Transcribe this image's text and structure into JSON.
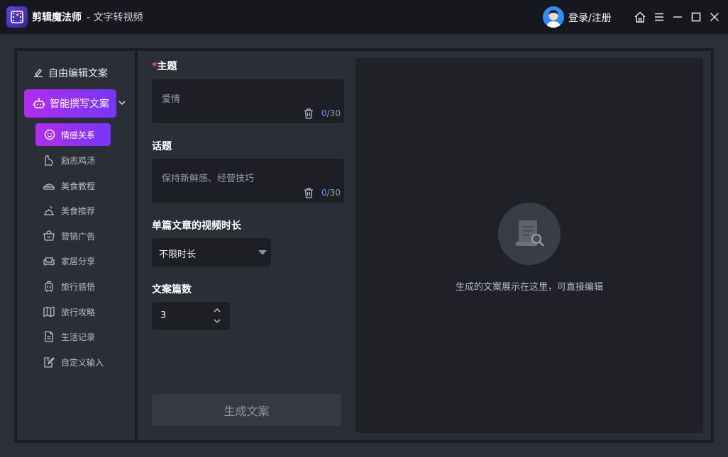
{
  "titlebar": {
    "app_name": "剪辑魔法师",
    "subtitle": "- 文字转视频",
    "login_label": "登录/注册"
  },
  "sidebar": {
    "free_edit_label": "自由编辑文案",
    "smart_write_label": "智能撰写文案",
    "items": [
      {
        "label": "情感关系",
        "icon": "smile-icon",
        "active": true
      },
      {
        "label": "励志鸡汤",
        "icon": "flex-arm-icon"
      },
      {
        "label": "美食教程",
        "icon": "cake-icon"
      },
      {
        "label": "美食推荐",
        "icon": "food-dish-icon"
      },
      {
        "label": "营销广告",
        "icon": "shopping-basket-icon"
      },
      {
        "label": "家居分享",
        "icon": "sofa-icon"
      },
      {
        "label": "旅行感悟",
        "icon": "luggage-icon"
      },
      {
        "label": "旅行攻略",
        "icon": "map-icon"
      },
      {
        "label": "生活记录",
        "icon": "document-icon"
      },
      {
        "label": "自定义输入",
        "icon": "edit-note-icon"
      }
    ]
  },
  "form": {
    "topic": {
      "required_mark": "*",
      "label": "主题",
      "value": "爱情",
      "count_current": "0",
      "count_max": "/30"
    },
    "subject": {
      "label": "话题",
      "value": "保持新鲜感、经营技巧",
      "count_current": "0",
      "count_max": "/30"
    },
    "duration": {
      "label": "单篇文章的视频时长",
      "selected": "不限时长"
    },
    "article_count": {
      "label": "文案篇数",
      "value": "3"
    },
    "generate_label": "生成文案"
  },
  "preview": {
    "empty_text": "生成的文案展示在这里，可直接编辑"
  },
  "colors": {
    "accent_start": "#b22cf0",
    "accent_end": "#7636f7",
    "count_highlight": "#4f9dff",
    "required": "#ff4d4f"
  }
}
